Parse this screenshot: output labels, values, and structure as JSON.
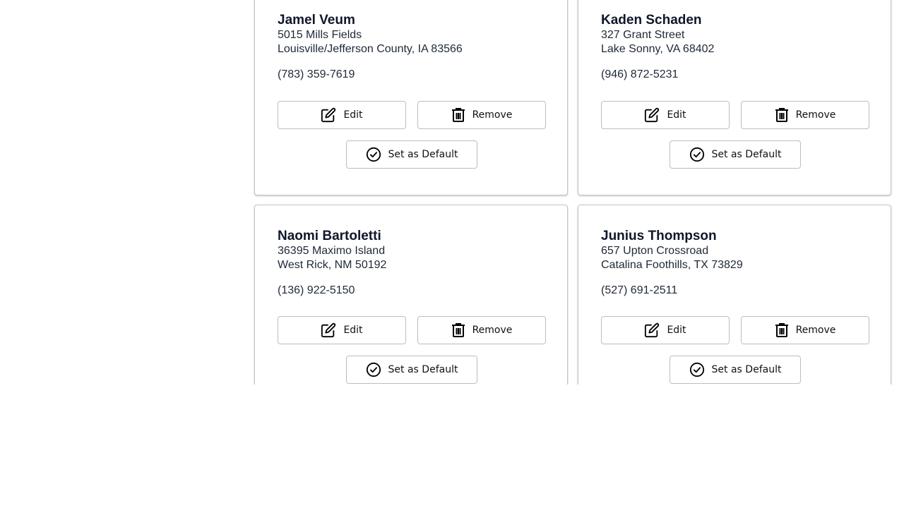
{
  "buttons": {
    "edit_label": "Edit",
    "remove_label": "Remove",
    "default_label": "Set as Default"
  },
  "addresses": [
    {
      "name": "Jamel Veum",
      "street": "5015 Mills Fields",
      "city_line": "Louisville/Jefferson County, IA 83566",
      "phone": "(783) 359-7619"
    },
    {
      "name": "Kaden Schaden",
      "street": "327 Grant Street",
      "city_line": "Lake Sonny, VA 68402",
      "phone": "(946) 872-5231"
    },
    {
      "name": "Naomi Bartoletti",
      "street": "36395 Maximo Island",
      "city_line": "West Rick, NM 50192",
      "phone": "(136) 922-5150"
    },
    {
      "name": "Junius Thompson",
      "street": "657 Upton Crossroad",
      "city_line": "Catalina Foothills, TX 73829",
      "phone": "(527) 691-2511"
    }
  ],
  "icons": {
    "edit": "edit-icon",
    "remove": "trash-icon",
    "default": "check-circle-icon"
  }
}
